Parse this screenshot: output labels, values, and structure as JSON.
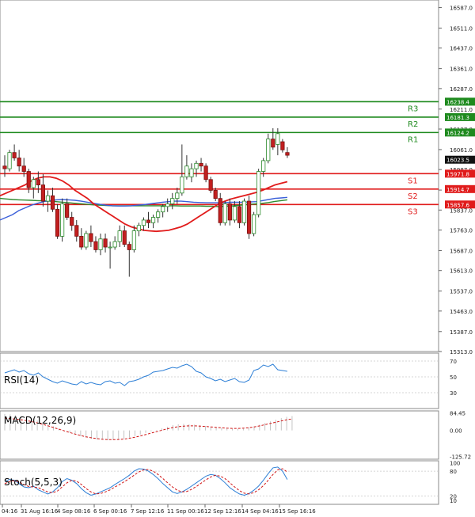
{
  "chart_data": {
    "type": "candlestick",
    "price_axis": {
      "ticks": [
        "16587.0",
        "16511.0",
        "16437.0",
        "16361.0",
        "16287.0",
        "16211.0",
        "16137.0",
        "16061.0",
        "15987.0",
        "15911.0",
        "15837.0",
        "15763.0",
        "15687.0",
        "15613.0",
        "15537.0",
        "15463.0",
        "15387.0",
        "15313.0"
      ],
      "current_price": "16023.5",
      "ylim": [
        15313,
        16615
      ]
    },
    "levels": [
      {
        "name": "R3",
        "value": 16238.4,
        "label": "16238.4",
        "color": "#1e8a1e"
      },
      {
        "name": "R2",
        "value": 16181.3,
        "label": "16181.3",
        "color": "#1e8a1e"
      },
      {
        "name": "R1",
        "value": 16124.2,
        "label": "16124.2",
        "color": "#1e8a1e"
      },
      {
        "name": "S1",
        "value": 15971.8,
        "label": "15971.8",
        "color": "#e01b1b"
      },
      {
        "name": "S2",
        "value": 15914.7,
        "label": "15914.7",
        "color": "#e01b1b"
      },
      {
        "name": "S3",
        "value": 15857.6,
        "label": "15857.6",
        "color": "#e01b1b"
      }
    ],
    "candles": [
      [
        16000,
        16040,
        15960,
        15990
      ],
      [
        15990,
        16060,
        15980,
        16050
      ],
      [
        16050,
        16080,
        16020,
        16030
      ],
      [
        16030,
        16060,
        15980,
        16000
      ],
      [
        16000,
        16030,
        15960,
        15980
      ],
      [
        15980,
        15990,
        15900,
        15920
      ],
      [
        15920,
        15960,
        15880,
        15950
      ],
      [
        15950,
        15980,
        15900,
        15930
      ],
      [
        15930,
        15970,
        15850,
        15870
      ],
      [
        15870,
        15910,
        15830,
        15890
      ],
      [
        15890,
        15920,
        15830,
        15840
      ],
      [
        15840,
        15860,
        15730,
        15740
      ],
      [
        15740,
        15880,
        15720,
        15860
      ],
      [
        15860,
        15880,
        15800,
        15810
      ],
      [
        15810,
        15830,
        15760,
        15780
      ],
      [
        15780,
        15800,
        15720,
        15740
      ],
      [
        15740,
        15770,
        15690,
        15700
      ],
      [
        15700,
        15760,
        15690,
        15750
      ],
      [
        15750,
        15780,
        15700,
        15720
      ],
      [
        15720,
        15740,
        15680,
        15690
      ],
      [
        15690,
        15750,
        15670,
        15730
      ],
      [
        15730,
        15750,
        15680,
        15700
      ],
      [
        15700,
        15720,
        15620,
        15700
      ],
      [
        15700,
        15740,
        15690,
        15720
      ],
      [
        15720,
        15780,
        15700,
        15760
      ],
      [
        15760,
        15780,
        15700,
        15710
      ],
      [
        15710,
        15720,
        15590,
        15690
      ],
      [
        15690,
        15780,
        15680,
        15760
      ],
      [
        15760,
        15790,
        15740,
        15780
      ],
      [
        15780,
        15810,
        15760,
        15800
      ],
      [
        15800,
        15830,
        15770,
        15790
      ],
      [
        15790,
        15820,
        15770,
        15810
      ],
      [
        15810,
        15840,
        15790,
        15830
      ],
      [
        15830,
        15860,
        15810,
        15850
      ],
      [
        15850,
        15880,
        15830,
        15860
      ],
      [
        15860,
        15900,
        15840,
        15880
      ],
      [
        15880,
        15920,
        15860,
        15900
      ],
      [
        15900,
        16080,
        15890,
        15960
      ],
      [
        15960,
        16040,
        15950,
        16000
      ],
      [
        15960,
        16010,
        15940,
        15990
      ],
      [
        15990,
        16020,
        15960,
        16010
      ],
      [
        16010,
        16030,
        15980,
        16000
      ],
      [
        16000,
        16010,
        15940,
        15950
      ],
      [
        15950,
        15960,
        15900,
        15910
      ],
      [
        15910,
        15920,
        15870,
        15880
      ],
      [
        15880,
        15900,
        15780,
        15790
      ],
      [
        15790,
        15870,
        15780,
        15860
      ],
      [
        15860,
        15880,
        15780,
        15800
      ],
      [
        15800,
        15870,
        15790,
        15850
      ],
      [
        15850,
        15870,
        15770,
        15790
      ],
      [
        15790,
        15880,
        15780,
        15870
      ],
      [
        15870,
        15890,
        15730,
        15750
      ],
      [
        15750,
        15830,
        15740,
        15820
      ],
      [
        15820,
        15990,
        15810,
        15980
      ],
      [
        15980,
        16030,
        15960,
        16020
      ],
      [
        16020,
        16120,
        16010,
        16100
      ],
      [
        16100,
        16140,
        16060,
        16070
      ],
      [
        16080,
        16140,
        16040,
        16120
      ],
      [
        16090,
        16100,
        16050,
        16060
      ],
      [
        16050,
        16070,
        16030,
        16040
      ]
    ],
    "ma_red": [
      15890,
      15900,
      15910,
      15920,
      15930,
      15945,
      15955,
      15960,
      15960,
      15955,
      15945,
      15930,
      15910,
      15895,
      15880,
      15860,
      15845,
      15830,
      15815,
      15800,
      15785,
      15775,
      15768,
      15762,
      15760,
      15758,
      15760,
      15762,
      15768,
      15775,
      15785,
      15800,
      15815,
      15830,
      15845,
      15860,
      15870,
      15878,
      15884,
      15890,
      15896,
      15902,
      15910,
      15920,
      15930,
      15936,
      15942
    ],
    "ma_blue": [
      15800,
      15810,
      15820,
      15835,
      15845,
      15855,
      15862,
      15868,
      15872,
      15875,
      15876,
      15875,
      15873,
      15870,
      15866,
      15862,
      15858,
      15855,
      15853,
      15852,
      15852,
      15853,
      15855,
      15857,
      15860,
      15863,
      15866,
      15868,
      15870,
      15870,
      15868,
      15866,
      15865,
      15864,
      15864,
      15864,
      15865,
      15866,
      15866,
      15866,
      15867,
      15868,
      15872,
      15876,
      15880,
      15882,
      15884
    ],
    "ma_green": [
      15880,
      15878,
      15876,
      15875,
      15874,
      15873,
      15872,
      15871,
      15870,
      15868,
      15866,
      15864,
      15862,
      15860,
      15858,
      15856,
      15855,
      15854,
      15853,
      15853,
      15853,
      15853,
      15853,
      15853,
      15853,
      15853,
      15853,
      15853,
      15853,
      15852,
      15852,
      15852,
      15852,
      15851,
      15851,
      15850,
      15851,
      15852,
      15854,
      15856,
      15858,
      15860,
      15862,
      15865,
      15869,
      15872,
      15875
    ],
    "x_labels": [
      "04:16",
      "31 Aug 16:16",
      "4 Sep 08:16",
      "6 Sep 00:16",
      "7 Sep 12:16",
      "11 Sep 00:16",
      "12 Sep 12:16",
      "14 Sep 04:16",
      "15 Sep 16:16"
    ],
    "rsi": {
      "label": "RSI(14)",
      "ticks": [
        "70",
        "50",
        "30"
      ],
      "ylim": [
        10,
        80
      ],
      "values": [
        55,
        57,
        59,
        56,
        58,
        54,
        52,
        55,
        50,
        47,
        44,
        42,
        45,
        43,
        41,
        40,
        44,
        41,
        43,
        41,
        40,
        44,
        45,
        42,
        43,
        39,
        44,
        45,
        47,
        50,
        52,
        56,
        57,
        58,
        60,
        62,
        61,
        64,
        66,
        63,
        57,
        55,
        50,
        48,
        45,
        47,
        44,
        46,
        48,
        44,
        43,
        46,
        58,
        60,
        65,
        63,
        66,
        59,
        58,
        57
      ]
    },
    "macd": {
      "label": "MACD(12,26,9)",
      "ticks": [
        "84.45",
        "0.00",
        "-125.72"
      ],
      "ylim": [
        -140,
        95
      ],
      "hist": [
        80,
        78,
        75,
        70,
        64,
        57,
        49,
        40,
        30,
        20,
        10,
        0,
        -10,
        -20,
        -28,
        -35,
        -40,
        -44,
        -46,
        -47,
        -46,
        -44,
        -40,
        -35,
        -28,
        -20,
        -12,
        -5,
        2,
        10,
        18,
        26,
        30,
        32,
        30,
        28,
        25,
        22,
        18,
        15,
        12,
        10,
        8,
        8,
        10,
        14,
        20,
        28,
        36,
        44,
        52,
        60,
        66,
        70
      ],
      "signal": [
        60,
        58,
        55,
        52,
        48,
        43,
        37,
        30,
        22,
        14,
        6,
        -2,
        -10,
        -18,
        -25,
        -31,
        -36,
        -40,
        -43,
        -45,
        -45,
        -44,
        -42,
        -38,
        -33,
        -27,
        -20,
        -13,
        -6,
        1,
        8,
        14,
        18,
        21,
        22,
        22,
        21,
        19,
        17,
        15,
        13,
        11,
        10,
        10,
        11,
        13,
        17,
        22,
        28,
        34,
        40,
        46,
        52,
        56
      ]
    },
    "stoch": {
      "label": "Stoch(5,5,3)",
      "ticks": [
        "100",
        "80",
        "20",
        "10"
      ],
      "ylim": [
        0,
        105
      ],
      "k": [
        55,
        60,
        58,
        50,
        42,
        40,
        44,
        35,
        30,
        25,
        30,
        40,
        55,
        62,
        58,
        50,
        38,
        28,
        22,
        25,
        30,
        35,
        40,
        48,
        55,
        62,
        70,
        80,
        86,
        85,
        80,
        72,
        62,
        50,
        40,
        30,
        26,
        30,
        36,
        44,
        52,
        60,
        68,
        72,
        70,
        62,
        52,
        40,
        32,
        25,
        22,
        26,
        34,
        44,
        58,
        74,
        88,
        90,
        80,
        60
      ],
      "d": [
        50,
        55,
        57,
        54,
        48,
        43,
        42,
        40,
        35,
        30,
        28,
        32,
        42,
        52,
        58,
        56,
        48,
        38,
        30,
        25,
        26,
        30,
        35,
        42,
        48,
        55,
        62,
        70,
        78,
        83,
        84,
        80,
        72,
        62,
        52,
        42,
        34,
        30,
        31,
        36,
        43,
        51,
        59,
        66,
        70,
        68,
        62,
        52,
        42,
        33,
        27,
        25,
        28,
        35,
        45,
        58,
        72,
        83,
        86,
        78
      ]
    }
  }
}
